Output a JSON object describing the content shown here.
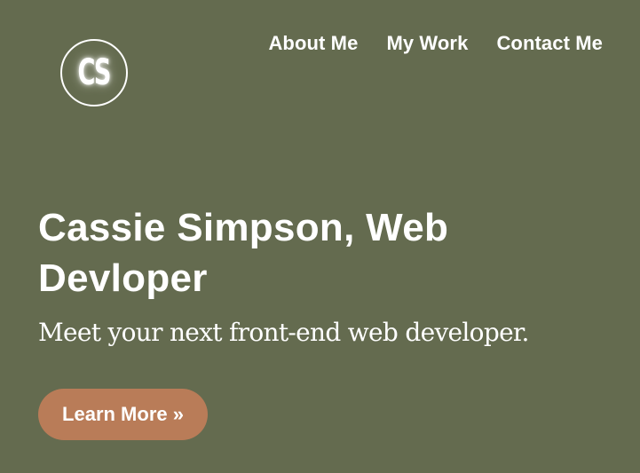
{
  "header": {
    "logo_text": "CS",
    "nav": {
      "about": "About Me",
      "work": "My Work",
      "contact": "Contact Me"
    }
  },
  "hero": {
    "title_line1": "Cassie Simpson, Web",
    "title_line2": "Devloper",
    "subtitle": "Meet your next front-end web developer.",
    "cta_label": "Learn More »"
  },
  "colors": {
    "background": "#646b4f",
    "accent": "#b97c58",
    "text": "#ffffff"
  }
}
